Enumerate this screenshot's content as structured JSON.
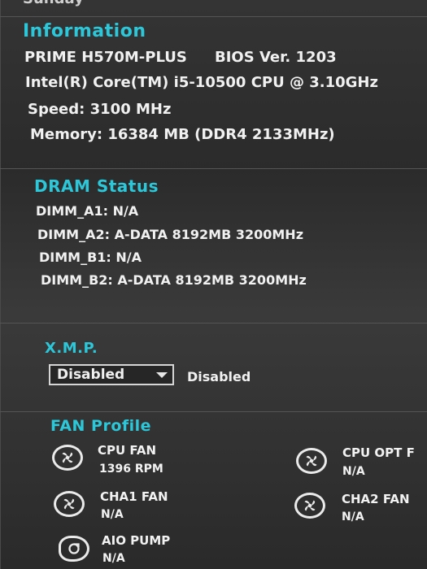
{
  "top_clip": "Sunday",
  "information": {
    "title": "Information",
    "board": "PRIME H570M-PLUS",
    "bios": "BIOS Ver. 1203",
    "cpu": "Intel(R) Core(TM) i5-10500 CPU @ 3.10GHz",
    "speed": "Speed: 3100 MHz",
    "memory": "Memory: 16384 MB (DDR4 2133MHz)"
  },
  "dram": {
    "title": "DRAM Status",
    "slots": [
      "DIMM_A1: N/A",
      "DIMM_A2: A-DATA 8192MB 3200MHz",
      "DIMM_B1: N/A",
      "DIMM_B2: A-DATA 8192MB 3200MHz"
    ]
  },
  "xmp": {
    "title": "X.M.P.",
    "selected": "Disabled",
    "status": "Disabled"
  },
  "fan": {
    "title": "FAN Profile",
    "items": [
      {
        "name": "CPU FAN",
        "value": "1396 RPM"
      },
      {
        "name": "CPU OPT F",
        "value": "N/A"
      },
      {
        "name": "CHA1 FAN",
        "value": "N/A"
      },
      {
        "name": "CHA2 FAN",
        "value": "N/A"
      },
      {
        "name": "AIO PUMP",
        "value": "N/A"
      }
    ]
  },
  "colors": {
    "accent": "#2cc7d9",
    "text": "#f1f1f1",
    "background": "#2b2b2b"
  },
  "icons": [
    "fan-icon",
    "pump-icon",
    "chevron-down-icon"
  ]
}
